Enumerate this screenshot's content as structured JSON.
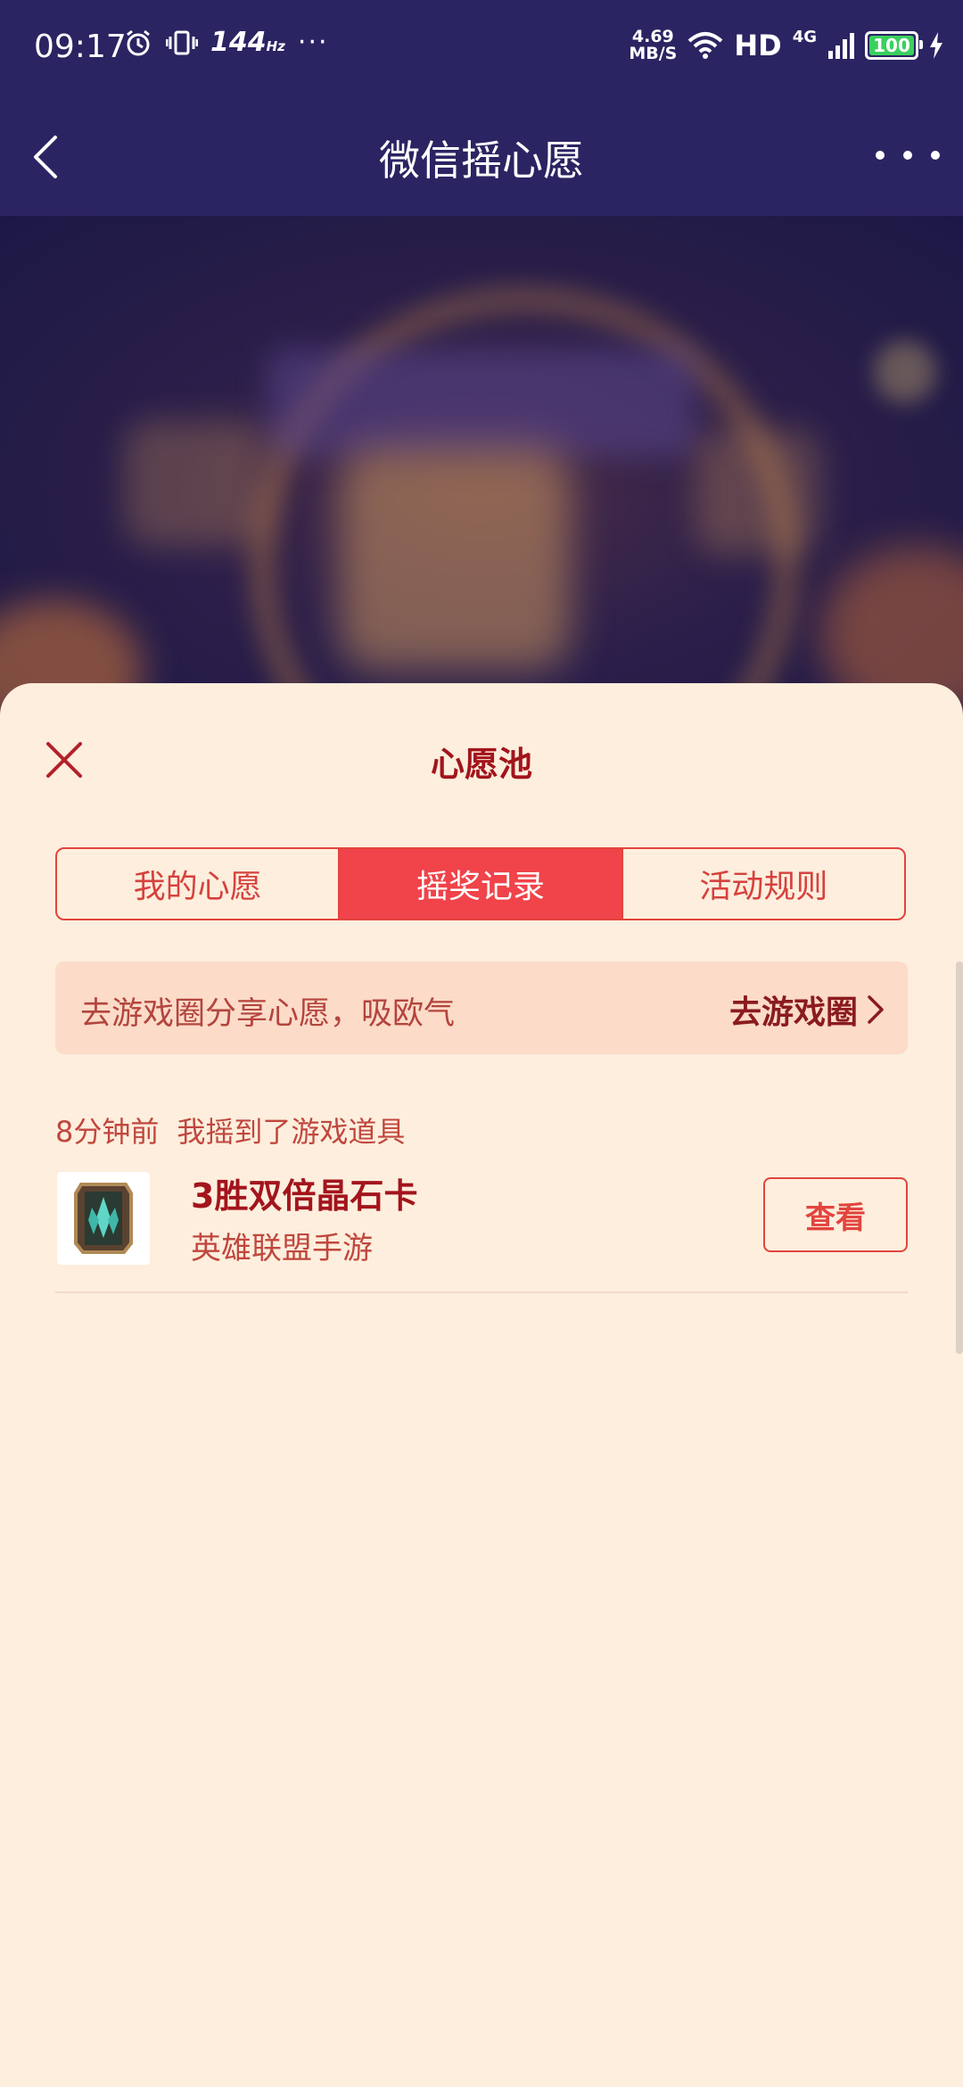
{
  "status_bar": {
    "time": "09:17",
    "refresh_rate": "144",
    "refresh_unit": "Hz",
    "more_dots": "···",
    "net_speed_value": "4.69",
    "net_speed_unit": "MB/S",
    "hd": "HD",
    "network": "4G",
    "battery": "100"
  },
  "navbar": {
    "title": "微信摇心愿"
  },
  "sheet": {
    "title": "心愿池",
    "tabs": [
      {
        "label": "我的心愿",
        "active": false
      },
      {
        "label": "摇奖记录",
        "active": true
      },
      {
        "label": "活动规则",
        "active": false
      }
    ],
    "share_banner": {
      "text": "去游戏圈分享心愿，吸欧气",
      "link": "去游戏圈"
    },
    "records": [
      {
        "time_ago": "8分钟前",
        "action": "我摇到了游戏道具",
        "item_name": "3胜双倍晶石卡",
        "game": "英雄联盟手游",
        "button": "查看"
      }
    ]
  },
  "colors": {
    "header_bg": "#2b2462",
    "sheet_bg": "#fdeedd",
    "accent_red": "#f0434a",
    "title_red": "#a3141c",
    "share_bg": "#fcdbc9"
  }
}
